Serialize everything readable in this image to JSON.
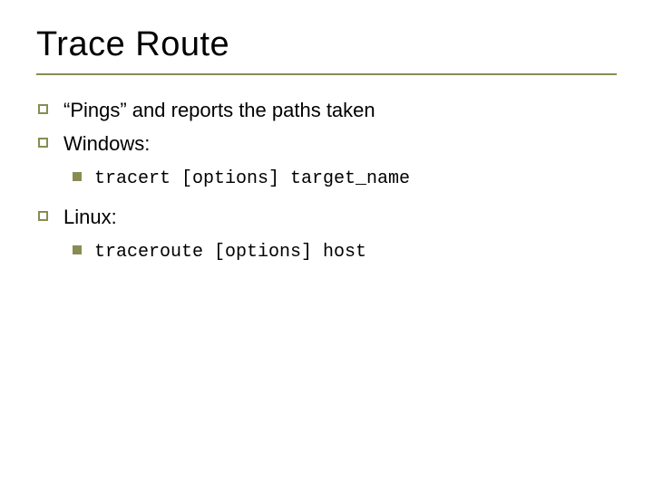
{
  "title": "Trace Route",
  "bullets": {
    "b1": "“Pings” and reports the paths taken",
    "b2": "Windows:",
    "b2_sub": "tracert [options] target_name",
    "b3": "Linux:",
    "b3_sub": "traceroute [options] host"
  }
}
